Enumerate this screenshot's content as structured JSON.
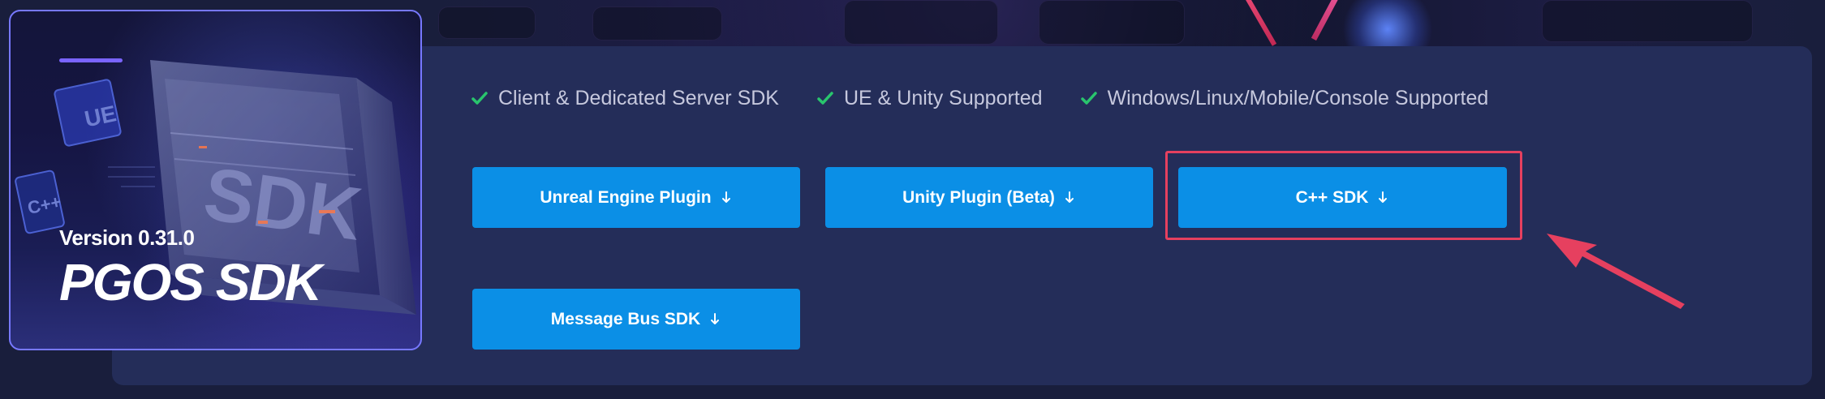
{
  "hero": {
    "version": "Version 0.31.0",
    "title": "PGOS SDK"
  },
  "features": [
    {
      "label": "Client & Dedicated Server SDK",
      "icon": "check-icon"
    },
    {
      "label": "UE & Unity Supported",
      "icon": "check-icon"
    },
    {
      "label": "Windows/Linux/Mobile/Console Supported",
      "icon": "check-icon"
    }
  ],
  "buttons": {
    "unreal": "Unreal Engine Plugin",
    "unity": "Unity Plugin (Beta)",
    "cpp": "C++ SDK",
    "message_bus": "Message Bus SDK",
    "icon": "download-arrow-icon"
  },
  "colors": {
    "panel": "#242d59",
    "button": "#0b8fe6",
    "check": "#29c56d",
    "highlight": "#e6405f",
    "hero_border": "#7778ff"
  }
}
